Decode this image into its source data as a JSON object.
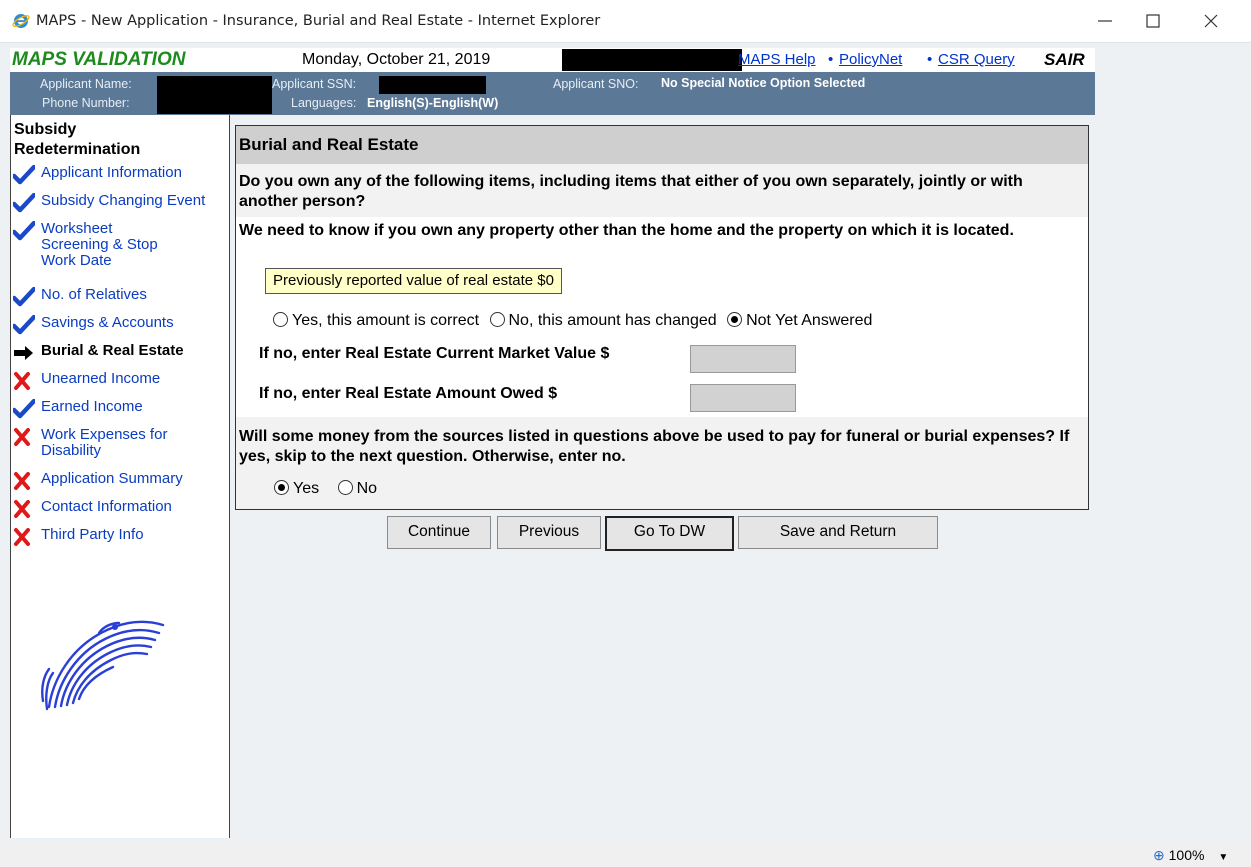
{
  "window": {
    "title": "MAPS - New Application - Insurance, Burial and Real Estate - Internet Explorer"
  },
  "header": {
    "app_name": "MAPS VALIDATION",
    "date": "Monday, October 21, 2019",
    "links": [
      "MAPS Help",
      "PolicyNet",
      "CSR Query"
    ],
    "separator": "•",
    "sair": "SAIR",
    "applicant_name_label": "Applicant Name:",
    "phone_label": "Phone Number:",
    "ssn_label": "Applicant SSN:",
    "languages_label": "Languages:",
    "languages_value": "English(S)-English(W)",
    "sno_label": "Applicant SNO:",
    "sno_value": "No Special Notice Option Selected"
  },
  "sidebar": {
    "title_line1": "Subsidy",
    "title_line2": "Redetermination",
    "items": [
      {
        "lines": [
          "Applicant Information"
        ],
        "status": "check-icon"
      },
      {
        "lines": [
          "Subsidy Changing Event"
        ],
        "status": "check-icon"
      },
      {
        "lines": [
          "Worksheet",
          "Screening  & Stop",
          "Work Date"
        ],
        "status": "check-icon"
      },
      {
        "lines": [
          "No. of Relatives"
        ],
        "status": "check-icon"
      },
      {
        "lines": [
          "Savings & Accounts"
        ],
        "status": "check-icon"
      },
      {
        "lines": [
          "Burial & Real Estate"
        ],
        "status": "arrow-right-icon"
      },
      {
        "lines": [
          "Unearned Income"
        ],
        "status": "x-icon"
      },
      {
        "lines": [
          "Earned Income"
        ],
        "status": "check-icon"
      },
      {
        "lines": [
          "Work Expenses for",
          "Disability"
        ],
        "status": "x-icon"
      },
      {
        "lines": [
          "Application Summary"
        ],
        "status": "x-icon"
      },
      {
        "lines": [
          "Contact Information"
        ],
        "status": "x-icon"
      },
      {
        "lines": [
          "Third Party Info"
        ],
        "status": "x-icon"
      }
    ],
    "colors": {
      "check": "#1a49c9",
      "x": "#e01818",
      "link": "#0a3cc0"
    }
  },
  "main": {
    "title": "Burial and Real Estate",
    "q1": "Do you own any of the following items, including items that either of you own separately, jointly or with another person?",
    "q2": "We need to know if you own any property other than the home and the property on which it is located.",
    "prev_value": "Previously reported value of real estate $0",
    "amount_options": [
      "Yes, this amount is correct",
      "No, this amount has changed",
      "Not Yet Answered"
    ],
    "amount_selected": 2,
    "market_value_label": "If no, enter Real Estate Current Market Value $",
    "market_value": "",
    "amount_owed_label": "If no, enter Real Estate Amount Owed $",
    "amount_owed": "",
    "q3": "Will some money from the sources listed in questions above be used to pay for funeral or burial expenses? If yes, skip to the next question. Otherwise, enter no.",
    "funeral_options": [
      "Yes",
      "No"
    ],
    "funeral_selected": 0
  },
  "buttons": {
    "continue": "Continue",
    "previous": "Previous",
    "go_to_dw": "Go To DW",
    "save_return": "Save and Return"
  },
  "status": {
    "zoom": "100%"
  }
}
